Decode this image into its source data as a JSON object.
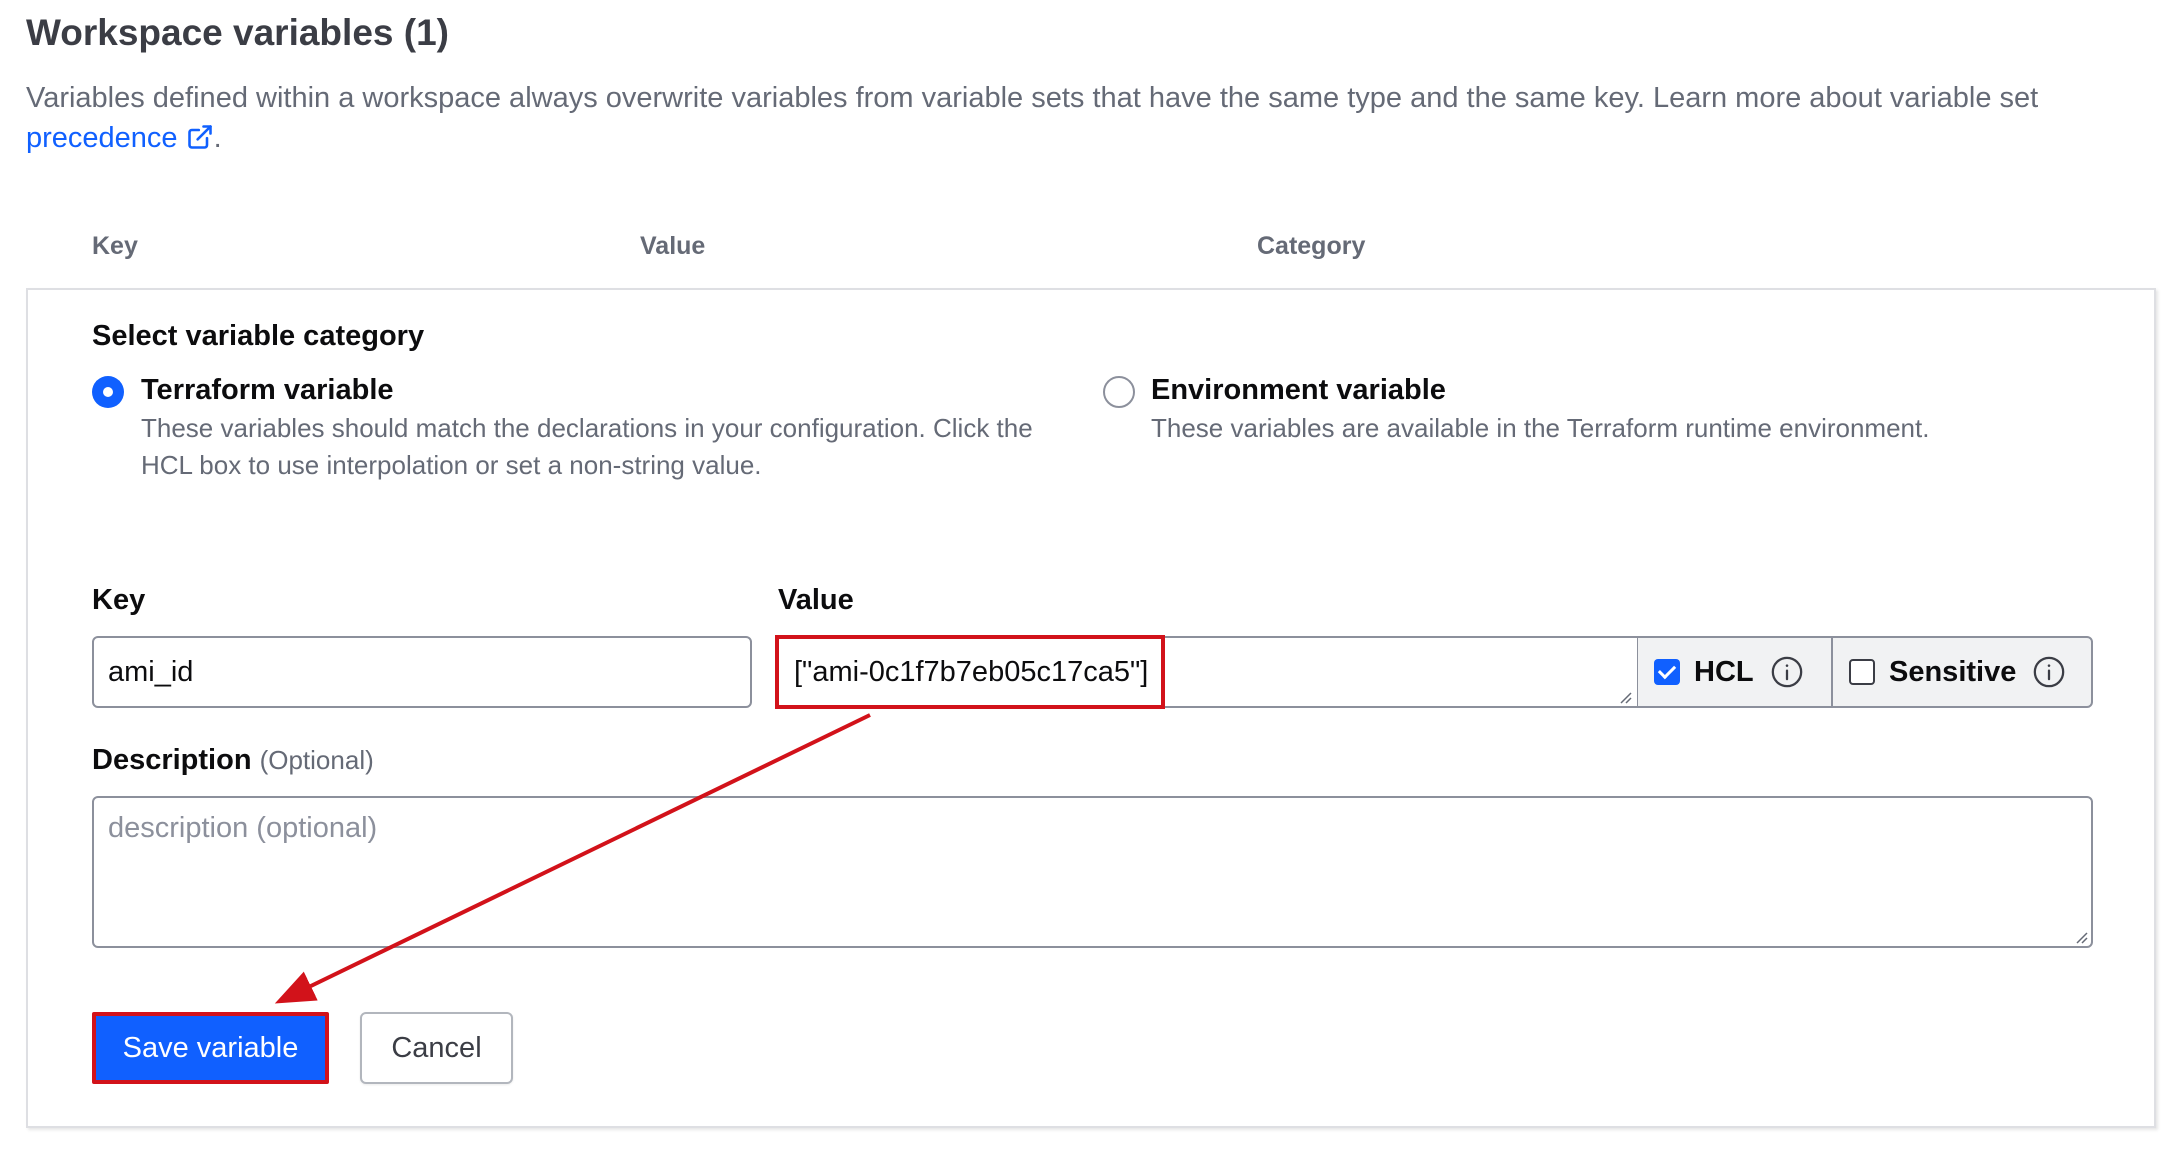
{
  "header": {
    "title": "Workspace variables (1)",
    "intro_text": "Variables defined within a workspace always overwrite variables from variable sets that have the same type and the same key. Learn more about variable set",
    "intro_link": "precedence",
    "intro_end": "."
  },
  "table_headers": {
    "key": "Key",
    "value": "Value",
    "category": "Category"
  },
  "category": {
    "title": "Select variable category",
    "terraform": {
      "label": "Terraform variable",
      "description": "These variables should match the declarations in your configuration. Click the HCL box to use interpolation or set a non-string value.",
      "selected": true
    },
    "environment": {
      "label": "Environment variable",
      "description": "These variables are available in the Terraform runtime environment.",
      "selected": false
    }
  },
  "form": {
    "key_label": "Key",
    "key_value": "ami_id",
    "value_label": "Value",
    "value_value": "[\"ami-0c1f7b7eb05c17ca5\"]",
    "hcl_label": "HCL",
    "hcl_checked": true,
    "sensitive_label": "Sensitive",
    "sensitive_checked": false,
    "description_label": "Description",
    "description_optional": "(Optional)",
    "description_placeholder": "description (optional)"
  },
  "buttons": {
    "save": "Save variable",
    "cancel": "Cancel"
  },
  "colors": {
    "accent": "#1060ff",
    "annotation": "#d2121a"
  },
  "icons": {
    "external_link": "external-link-icon",
    "info": "info-icon",
    "resize": "resize-grip-icon"
  }
}
